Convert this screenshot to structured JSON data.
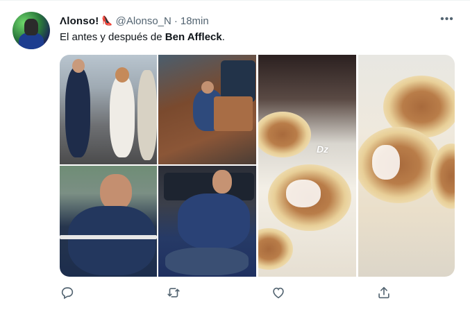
{
  "tweet": {
    "display_name": "Λlonso!",
    "badge_icon": "heel-icon",
    "handle": "@Alonso_N",
    "separator": "·",
    "time": "18min",
    "more_label": "•••",
    "text_prefix": "El antes y después de ",
    "text_bold": "Ben Affleck",
    "text_suffix": "."
  },
  "media": {
    "images": [
      {
        "label": "photo-couple-walking"
      },
      {
        "label": "photo-man-on-deck"
      },
      {
        "label": "photo-man-resting-on-boat"
      },
      {
        "label": "photo-man-reclining"
      },
      {
        "label": "photo-pancakes-plate"
      },
      {
        "label": "photo-pancakes-closeup"
      }
    ],
    "watermark": "Dz"
  },
  "actions": {
    "reply_icon": "reply-icon",
    "retweet_icon": "retweet-icon",
    "like_icon": "heart-icon",
    "share_icon": "share-icon"
  },
  "colors": {
    "text_primary": "#0f1419",
    "text_secondary": "#536471",
    "background": "#ffffff"
  }
}
